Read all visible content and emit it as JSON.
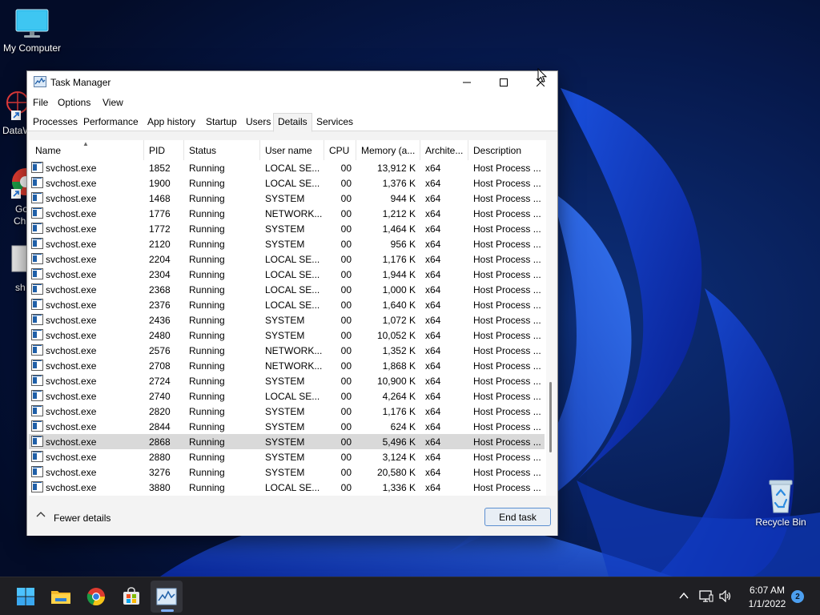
{
  "desktop": {
    "icons": [
      {
        "label": "My Computer"
      },
      {
        "label": "DataW"
      },
      {
        "label": "Go"
      },
      {
        "label": "Ch"
      },
      {
        "label": "sh"
      },
      {
        "label": "Recycle Bin"
      }
    ]
  },
  "window": {
    "title": "Task Manager",
    "menu": [
      "File",
      "Options",
      "View"
    ],
    "tabs": [
      "Processes",
      "Performance",
      "App history",
      "Startup",
      "Users",
      "Details",
      "Services"
    ],
    "active_tab": "Details",
    "columns": [
      "Name",
      "PID",
      "Status",
      "User name",
      "CPU",
      "Memory (a...",
      "Archite...",
      "Description"
    ],
    "rows": [
      {
        "name": "svchost.exe",
        "pid": "1852",
        "status": "Running",
        "user": "LOCAL SE...",
        "cpu": "00",
        "memory": "13,912 K",
        "arch": "x64",
        "desc": "Host Process ..."
      },
      {
        "name": "svchost.exe",
        "pid": "1900",
        "status": "Running",
        "user": "LOCAL SE...",
        "cpu": "00",
        "memory": "1,376 K",
        "arch": "x64",
        "desc": "Host Process ..."
      },
      {
        "name": "svchost.exe",
        "pid": "1468",
        "status": "Running",
        "user": "SYSTEM",
        "cpu": "00",
        "memory": "944 K",
        "arch": "x64",
        "desc": "Host Process ..."
      },
      {
        "name": "svchost.exe",
        "pid": "1776",
        "status": "Running",
        "user": "NETWORK...",
        "cpu": "00",
        "memory": "1,212 K",
        "arch": "x64",
        "desc": "Host Process ..."
      },
      {
        "name": "svchost.exe",
        "pid": "1772",
        "status": "Running",
        "user": "SYSTEM",
        "cpu": "00",
        "memory": "1,464 K",
        "arch": "x64",
        "desc": "Host Process ..."
      },
      {
        "name": "svchost.exe",
        "pid": "2120",
        "status": "Running",
        "user": "SYSTEM",
        "cpu": "00",
        "memory": "956 K",
        "arch": "x64",
        "desc": "Host Process ..."
      },
      {
        "name": "svchost.exe",
        "pid": "2204",
        "status": "Running",
        "user": "LOCAL SE...",
        "cpu": "00",
        "memory": "1,176 K",
        "arch": "x64",
        "desc": "Host Process ..."
      },
      {
        "name": "svchost.exe",
        "pid": "2304",
        "status": "Running",
        "user": "LOCAL SE...",
        "cpu": "00",
        "memory": "1,944 K",
        "arch": "x64",
        "desc": "Host Process ..."
      },
      {
        "name": "svchost.exe",
        "pid": "2368",
        "status": "Running",
        "user": "LOCAL SE...",
        "cpu": "00",
        "memory": "1,000 K",
        "arch": "x64",
        "desc": "Host Process ..."
      },
      {
        "name": "svchost.exe",
        "pid": "2376",
        "status": "Running",
        "user": "LOCAL SE...",
        "cpu": "00",
        "memory": "1,640 K",
        "arch": "x64",
        "desc": "Host Process ..."
      },
      {
        "name": "svchost.exe",
        "pid": "2436",
        "status": "Running",
        "user": "SYSTEM",
        "cpu": "00",
        "memory": "1,072 K",
        "arch": "x64",
        "desc": "Host Process ..."
      },
      {
        "name": "svchost.exe",
        "pid": "2480",
        "status": "Running",
        "user": "SYSTEM",
        "cpu": "00",
        "memory": "10,052 K",
        "arch": "x64",
        "desc": "Host Process ..."
      },
      {
        "name": "svchost.exe",
        "pid": "2576",
        "status": "Running",
        "user": "NETWORK...",
        "cpu": "00",
        "memory": "1,352 K",
        "arch": "x64",
        "desc": "Host Process ..."
      },
      {
        "name": "svchost.exe",
        "pid": "2708",
        "status": "Running",
        "user": "NETWORK...",
        "cpu": "00",
        "memory": "1,868 K",
        "arch": "x64",
        "desc": "Host Process ..."
      },
      {
        "name": "svchost.exe",
        "pid": "2724",
        "status": "Running",
        "user": "SYSTEM",
        "cpu": "00",
        "memory": "10,900 K",
        "arch": "x64",
        "desc": "Host Process ..."
      },
      {
        "name": "svchost.exe",
        "pid": "2740",
        "status": "Running",
        "user": "LOCAL SE...",
        "cpu": "00",
        "memory": "4,264 K",
        "arch": "x64",
        "desc": "Host Process ..."
      },
      {
        "name": "svchost.exe",
        "pid": "2820",
        "status": "Running",
        "user": "SYSTEM",
        "cpu": "00",
        "memory": "1,176 K",
        "arch": "x64",
        "desc": "Host Process ..."
      },
      {
        "name": "svchost.exe",
        "pid": "2844",
        "status": "Running",
        "user": "SYSTEM",
        "cpu": "00",
        "memory": "624 K",
        "arch": "x64",
        "desc": "Host Process ..."
      },
      {
        "name": "svchost.exe",
        "pid": "2868",
        "status": "Running",
        "user": "SYSTEM",
        "cpu": "00",
        "memory": "5,496 K",
        "arch": "x64",
        "desc": "Host Process ...",
        "selected": true
      },
      {
        "name": "svchost.exe",
        "pid": "2880",
        "status": "Running",
        "user": "SYSTEM",
        "cpu": "00",
        "memory": "3,124 K",
        "arch": "x64",
        "desc": "Host Process ..."
      },
      {
        "name": "svchost.exe",
        "pid": "3276",
        "status": "Running",
        "user": "SYSTEM",
        "cpu": "00",
        "memory": "20,580 K",
        "arch": "x64",
        "desc": "Host Process ..."
      },
      {
        "name": "svchost.exe",
        "pid": "3880",
        "status": "Running",
        "user": "LOCAL SE...",
        "cpu": "00",
        "memory": "1,336 K",
        "arch": "x64",
        "desc": "Host Process ..."
      }
    ],
    "footer": {
      "fewer_details": "Fewer details",
      "end_task": "End task"
    }
  },
  "taskbar": {
    "apps": [
      "start-icon",
      "file-explorer-icon",
      "chrome-icon",
      "store-icon",
      "task-manager-icon"
    ],
    "clock": {
      "time": "6:07 AM",
      "date": "1/1/2022"
    },
    "notifications": "2"
  },
  "colors": {
    "accent": "#0067c0",
    "selection": "#d9d9d9",
    "taskbar": "#1f1f23"
  }
}
